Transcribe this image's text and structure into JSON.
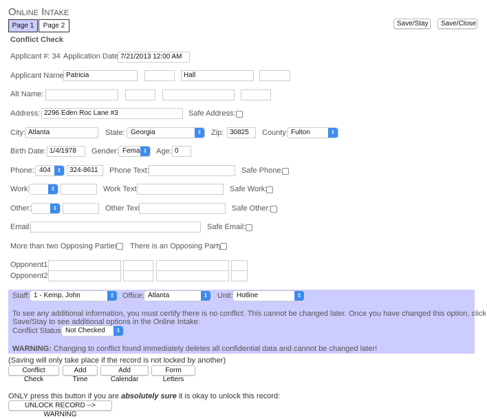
{
  "title": "Online Intake",
  "tabs": [
    {
      "label": "Page 1",
      "active": true
    },
    {
      "label": "Page 2",
      "active": false
    }
  ],
  "toolbar": {
    "save_stay": "Save/Stay",
    "save_close": "Save/Close"
  },
  "section_title": "Conflict Check",
  "applicant": {
    "number_label": "Applicant #: 34",
    "date_label": "Application Date:",
    "date": "7/21/2013 12:00 AM",
    "name_label": "Applicant Name:",
    "first": "Patricia",
    "middle": "",
    "last": "Hall",
    "suffix": "",
    "alt_label": "Alt Name:",
    "address_label": "Address:",
    "address": "2296 Eden Roc Lane #3",
    "safe_address": "Safe Address:",
    "city_label": "City:",
    "city": "Atlanta",
    "state_label": "State:",
    "state": "Georgia",
    "zip_label": "Zip:",
    "zip": "30825",
    "county_label": "County:",
    "county": "Fulton",
    "birth_label": "Birth Date:",
    "birth": "1/4/1978",
    "gender_label": "Gender:",
    "gender": "Fema",
    "age_label": "Age:",
    "age": "0",
    "phone_label": "Phone:",
    "phone_area": "404",
    "phone": "324-8611",
    "phone_text": "Phone Text:",
    "safe_phone": "Safe Phone:",
    "work_label": "Work:",
    "work_text": "Work Text:",
    "safe_work": "Safe Work:",
    "other_label": "Other:",
    "other_text": "Other Text:",
    "safe_other": "Safe Other:",
    "email_label": "Email:",
    "safe_email": "Safe Email:",
    "more_parties": "More than two Opposing Parties:",
    "opposing_party": "There is an Opposing Party:",
    "opponent1": "Opponent1:",
    "opponent2": "Opponent2:"
  },
  "assignment": {
    "staff_label": "Staff:",
    "staff": "1 - Kemp, John",
    "office_label": "Office:",
    "office": "Atlanta",
    "unit_label": "Unit:",
    "unit": "Hotline",
    "info1": "To see any additional information, you must certify there is no conflict.  This cannot be changed later.  Once you have changed this option, click",
    "info2": "Save/Stay to see additional options in the Online Intake:",
    "status_label": "Conflict Status:",
    "status": "Not Checked",
    "warning_bold": "WARNING:",
    "warning": " Changing to conflict found immediately deletes all confidential data and cannot be changed later!"
  },
  "footer": {
    "saving_note": "(Saving will only take place if the record is not locked by another)",
    "buttons": [
      "Conflict Check",
      "Add Time",
      "Add Calendar",
      "Form Letters"
    ],
    "unlock_pre": "ONLY press this button if you are ",
    "unlock_em": "absolutely sure",
    "unlock_post": " it is okay to unlock this record:",
    "unlock_button": "UNLOCK RECORD --> WARNING"
  },
  "colors": {
    "panel": "#ccccff",
    "active_tab": "#ccccff",
    "select_arrow": "#3b8cf0"
  }
}
